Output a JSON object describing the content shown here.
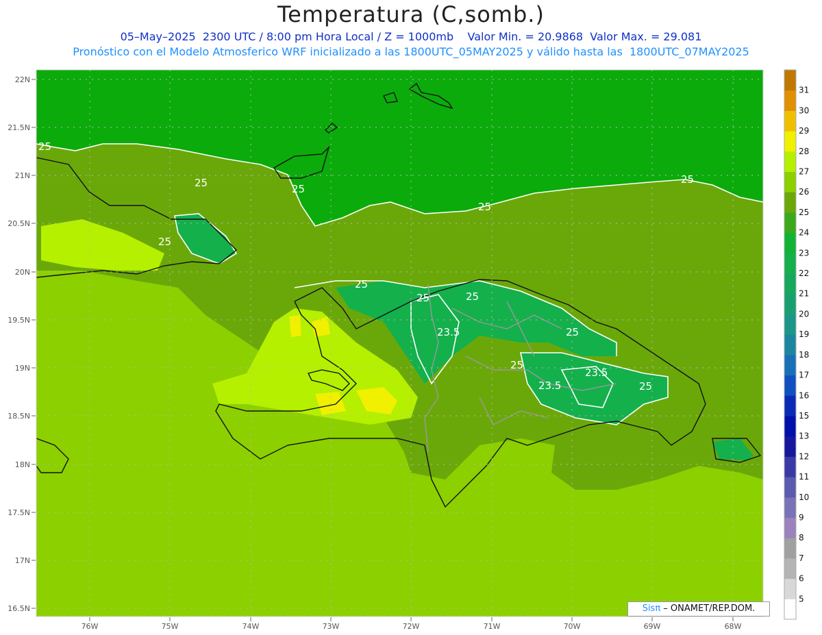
{
  "title": "Temperatura (C,somb.)",
  "subtitle_line1": "05–May–2025  2300 UTC / 8:00 pm Hora Local / Z = 1000mb    Valor Min. = 20.9868  Valor Max. = 29.081",
  "subtitle_line2": "Pronóstico con el Modelo Atmosferico WRF inicializado a las 1800UTC_05MAY2025 y válido hasta las  1800UTC_07MAY2025",
  "latitude_labels": [
    "22N",
    "21.5N",
    "21N",
    "20.5N",
    "20N",
    "19.5N",
    "19N",
    "18.5N",
    "18N",
    "17.5N",
    "17N",
    "16.5N"
  ],
  "longitude_labels": [
    "76W",
    "75W",
    "74W",
    "73W",
    "72W",
    "71W",
    "70W",
    "69W",
    "68W"
  ],
  "colorbar": {
    "labels": [
      "5",
      "6",
      "7",
      "8",
      "9",
      "10",
      "11",
      "12",
      "13",
      "15",
      "16",
      "17",
      "18",
      "19",
      "20",
      "21",
      "22",
      "23",
      "24",
      "25",
      "26",
      "27",
      "28",
      "29",
      "30",
      "31"
    ],
    "colors": [
      "#ffffff",
      "#d8d8d8",
      "#b4b4b4",
      "#a0a0a0",
      "#9a82be",
      "#7a72b6",
      "#5a5aae",
      "#3a3aa6",
      "#16169e",
      "#0010aa",
      "#0a2ab6",
      "#1050c0",
      "#1870b8",
      "#1c86a0",
      "#1c9688",
      "#18a070",
      "#16a85c",
      "#14b04c",
      "#10b434",
      "#3ca81c",
      "#6aa80a",
      "#8cd000",
      "#b4f000",
      "#f0f000",
      "#f0c000",
      "#e09000",
      "#c07800"
    ]
  },
  "contour_labels": [
    "25",
    "25",
    "25",
    "25",
    "25",
    "25",
    "25",
    "25",
    "25",
    "23.5",
    "25",
    "25",
    "23.5",
    "23.5",
    "25"
  ],
  "credit": {
    "brand": "Sisπ",
    "text": " – ONAMET/REP.DOM."
  },
  "colors": {
    "sea_north": "#0bab0b",
    "sea_mid": "#6aa80a",
    "sea_south": "#8cd000",
    "warm": "#b4f000",
    "hot": "#f0f000",
    "cool_land": "#14b04c",
    "coast": "#111111",
    "border": "#999999",
    "contour": "#ffffff"
  }
}
